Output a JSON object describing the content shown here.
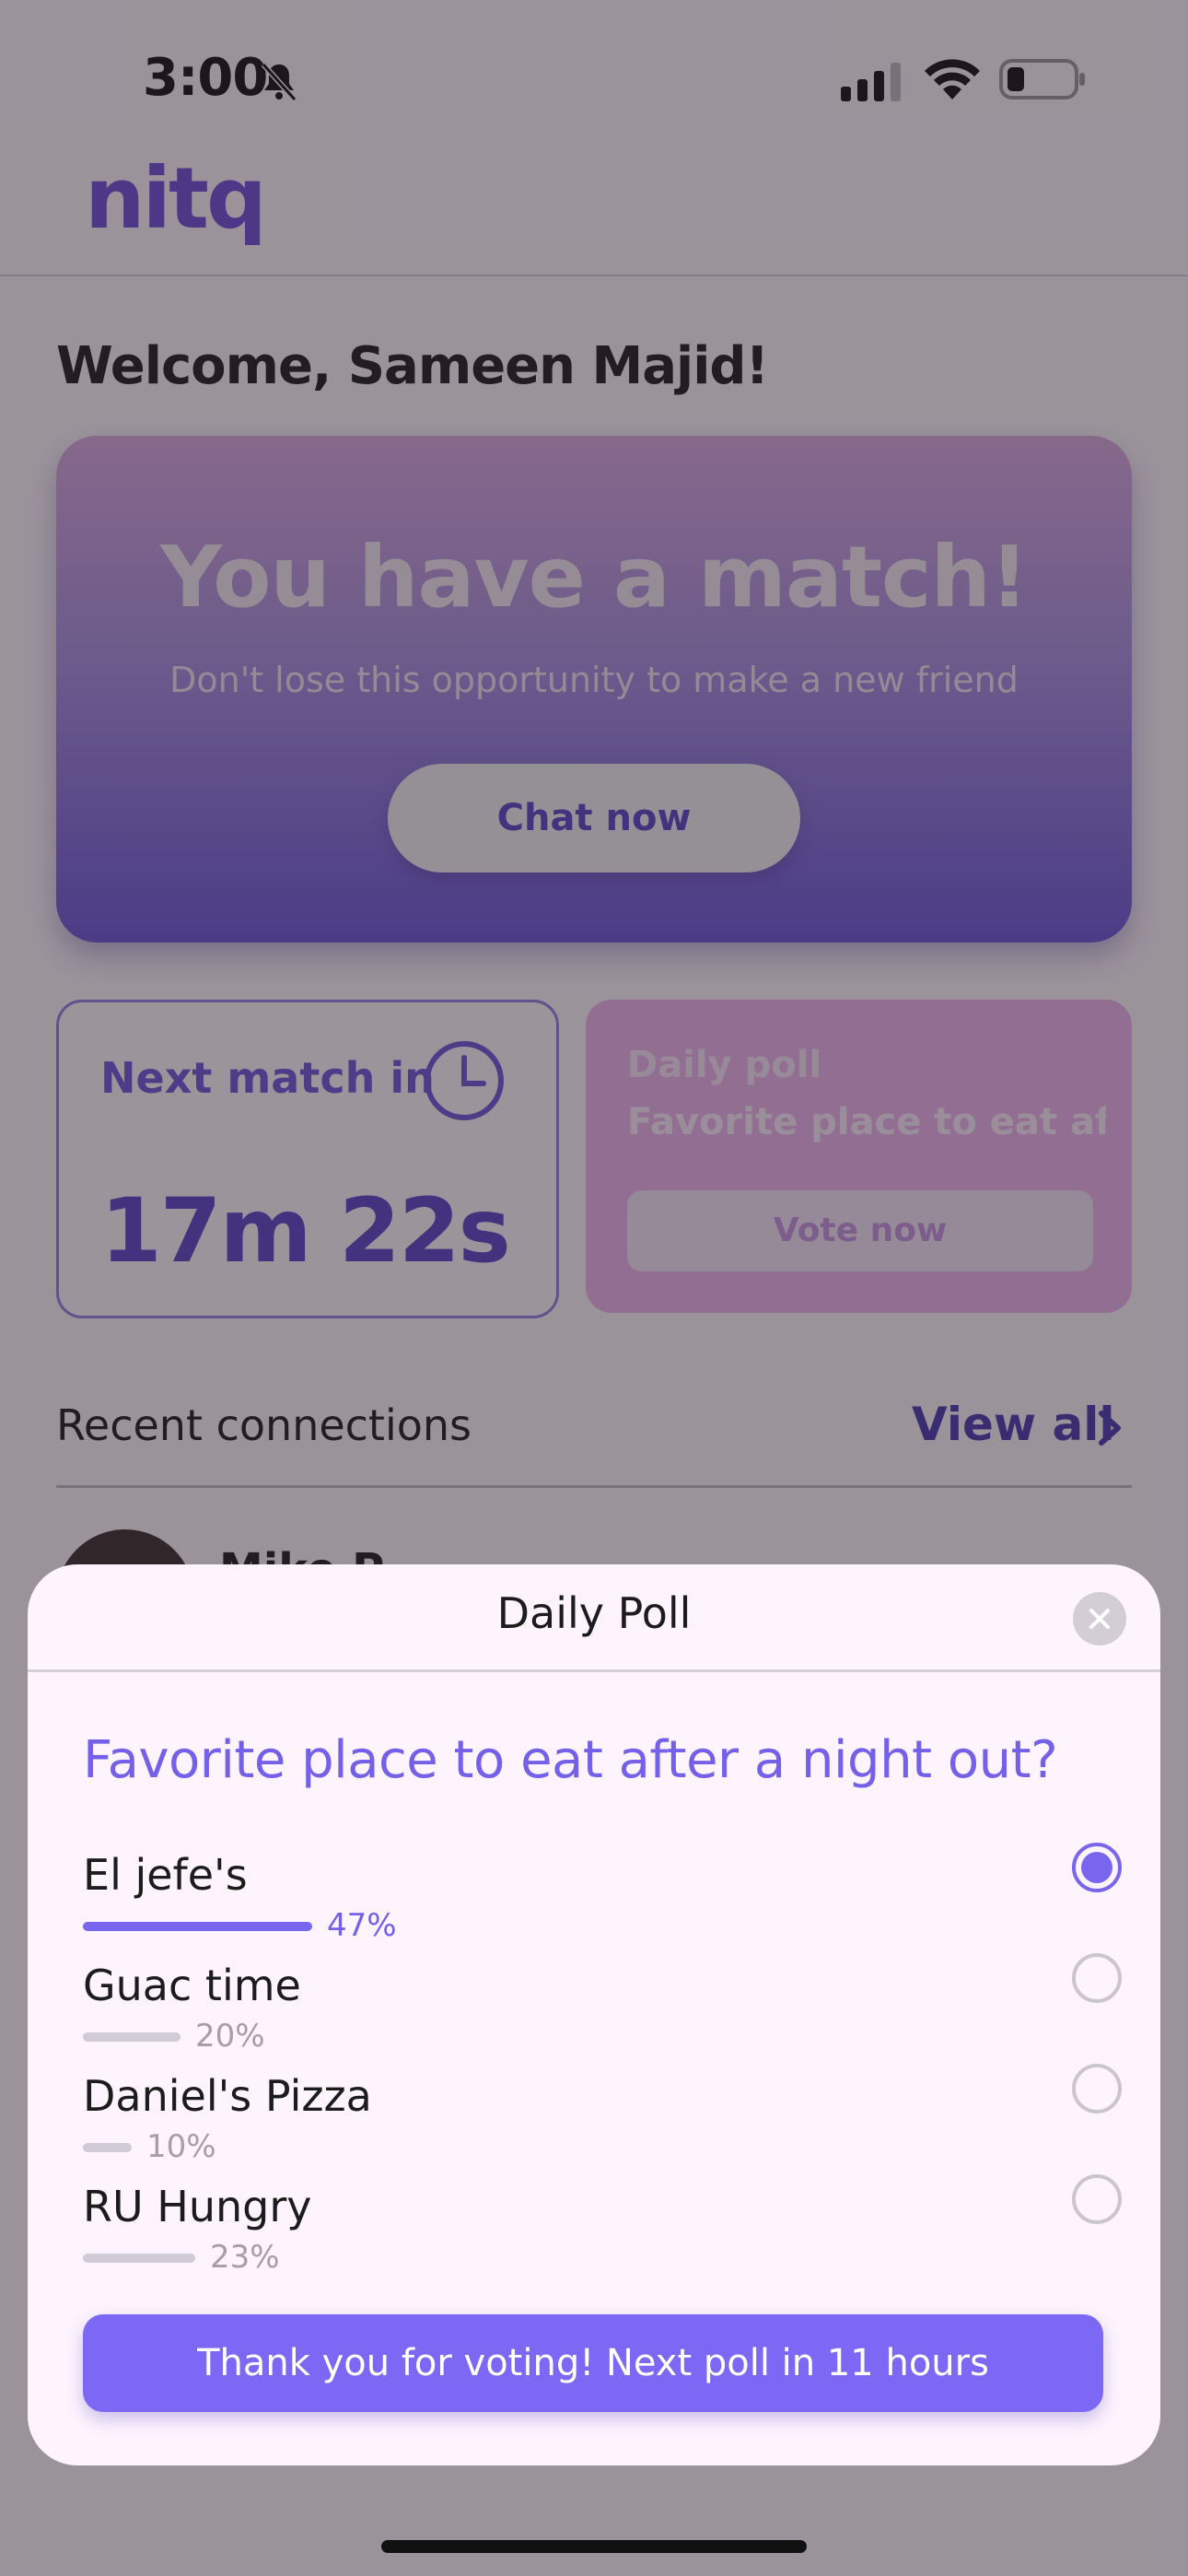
{
  "status_bar": {
    "time": "3:00"
  },
  "header": {
    "logo_text": "nitq"
  },
  "welcome": "Welcome, Sameen Majid!",
  "match_card": {
    "title": "You have a match!",
    "subtitle": "Don't lose this opportunity to make a new friend",
    "button": "Chat now"
  },
  "next_match": {
    "label": "Next match in",
    "value": "17m 22s"
  },
  "daily_poll_card": {
    "label": "Daily poll",
    "question": "Favorite place to eat aft...",
    "button": "Vote now"
  },
  "recent": {
    "label": "Recent connections",
    "view_all": "View all",
    "first_contact": "Mike P..."
  },
  "modal": {
    "title": "Daily Poll",
    "question": "Favorite place to eat after a night out?",
    "options": [
      {
        "label": "El jefe's",
        "percent_text": "47%",
        "percent": 47,
        "selected": true
      },
      {
        "label": "Guac time",
        "percent_text": "20%",
        "percent": 20,
        "selected": false
      },
      {
        "label": "Daniel's Pizza",
        "percent_text": "10%",
        "percent": 10,
        "selected": false
      },
      {
        "label": "RU Hungry",
        "percent_text": "23%",
        "percent": 23,
        "selected": false
      }
    ],
    "footer_message": "Thank you for voting! Next poll in 11 hours"
  },
  "colors": {
    "accent": "#7966ee",
    "brand": "#6c4fd6",
    "poll_card": "#eeb2ee"
  }
}
